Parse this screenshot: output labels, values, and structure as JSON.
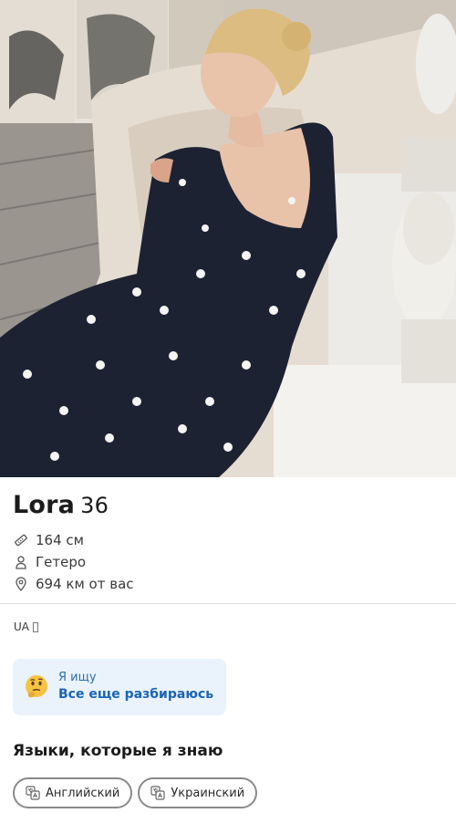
{
  "profile": {
    "name": "Lora",
    "age": "36",
    "height": "164 см",
    "orientation": "Гетеро",
    "distance": "694 км от вас"
  },
  "location_code": "UA",
  "looking_for": {
    "label": "Я ищу",
    "value": "Все еще разбираюсь",
    "emoji": "thinking-face"
  },
  "languages": {
    "title": "Языки, которые я знаю",
    "items": [
      "Английский",
      "Украинский"
    ]
  },
  "colors": {
    "accent_text": "#1a64b8",
    "card_bg": "#eaf3fb",
    "chip_border": "#8a8a8a"
  }
}
